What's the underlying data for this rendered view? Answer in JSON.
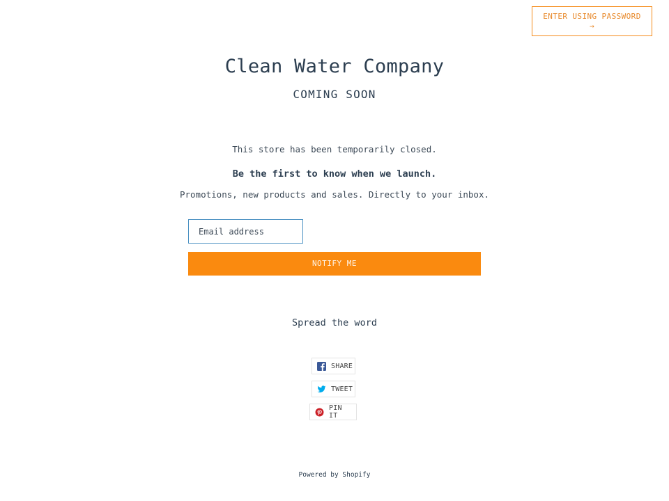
{
  "header": {
    "password_button_label": "ENTER USING PASSWORD",
    "password_button_arrow": "→"
  },
  "store": {
    "title": "Clean Water Company",
    "subtitle": "COMING SOON"
  },
  "content": {
    "closed_message": "This store has been temporarily closed.",
    "launch_heading": "Be the first to know when we launch.",
    "promo_text": "Promotions, new products and sales. Directly to your inbox."
  },
  "signup": {
    "email_placeholder": "Email address",
    "email_value": "",
    "notify_label": "NOTIFY ME"
  },
  "social": {
    "heading": "Spread the word",
    "buttons": [
      {
        "label": "SHARE",
        "icon": "facebook-icon",
        "color": "#3b5998"
      },
      {
        "label": "TWEET",
        "icon": "twitter-icon",
        "color": "#00aced"
      },
      {
        "label": "PIN IT",
        "icon": "pinterest-icon",
        "color": "#cb2027"
      }
    ]
  },
  "footer": {
    "powered_by": "Powered by Shopify"
  },
  "colors": {
    "accent": "#fa8a0f",
    "text": "#2c3e50"
  }
}
